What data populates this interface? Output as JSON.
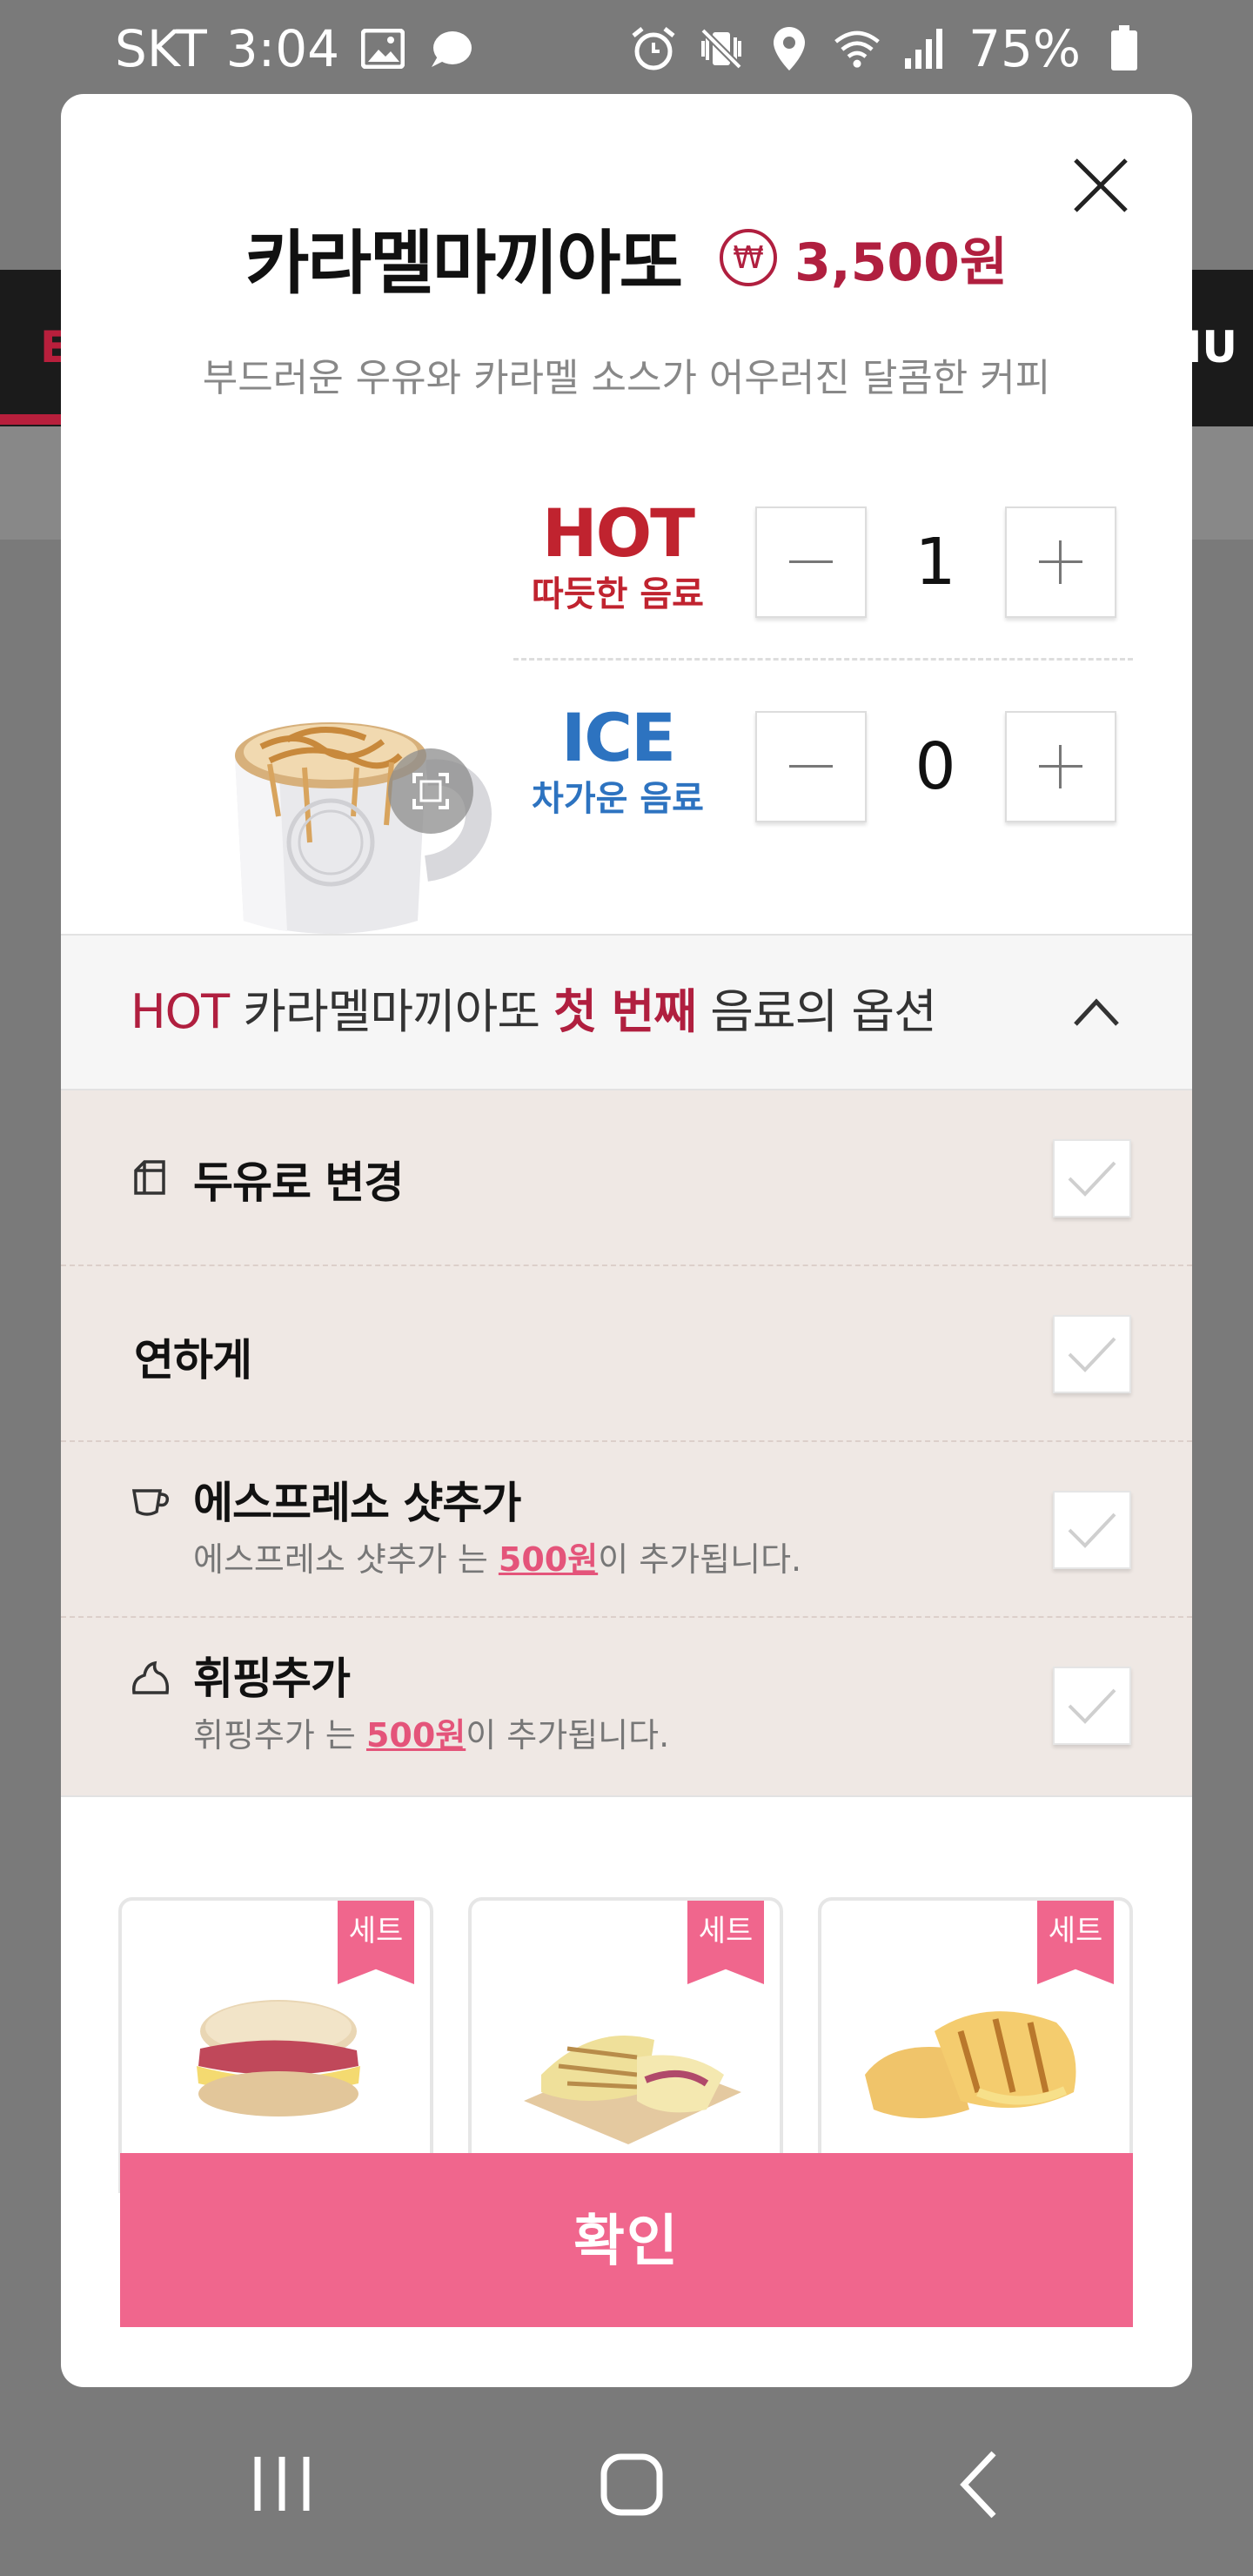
{
  "status_bar": {
    "carrier": "SKT",
    "time": "3:04",
    "battery": "75%"
  },
  "background": {
    "left_fragment": "E",
    "right_fragment": "NU"
  },
  "product": {
    "name": "카라멜마끼아또",
    "currency_icon": "₩",
    "price": "3,500원",
    "description": "부드러운 우유와 카라멜 소스가 어우러진 달콤한 커피"
  },
  "temperatures": [
    {
      "label": "HOT",
      "sublabel": "따듯한 음료",
      "quantity": "1",
      "color": "#c0232f"
    },
    {
      "label": "ICE",
      "sublabel": "차가운 음료",
      "quantity": "0",
      "color": "#2d73c0"
    }
  ],
  "options_header": {
    "prefix": "HOT",
    "name": " 카라멜마끼아또 ",
    "ordinal": "첫 번째",
    "suffix": " 음료의 옵션"
  },
  "options": [
    {
      "title": "두유로 변경",
      "icon": "milk-carton-icon",
      "desc_prefix": "",
      "desc_price": "",
      "desc_suffix": "",
      "checked": false
    },
    {
      "title": "연하게",
      "icon": "",
      "desc_prefix": "",
      "desc_price": "",
      "desc_suffix": "",
      "checked": false
    },
    {
      "title": "에스프레소 샷추가",
      "icon": "cup-icon",
      "desc_prefix": "에스프레소 샷추가 는 ",
      "desc_price": "500원",
      "desc_suffix": "이 추가됩니다.",
      "checked": false
    },
    {
      "title": "휘핑추가",
      "icon": "whipped-cream-icon",
      "desc_prefix": "휘핑추가 는 ",
      "desc_price": "500원",
      "desc_suffix": "이 추가됩니다.",
      "checked": false
    }
  ],
  "set_menu": {
    "badge": "세트",
    "items": [
      "muffin-sandwich",
      "panini-plate",
      "grilled-panini"
    ]
  },
  "confirm_label": "확인",
  "colors": {
    "brand_red": "#b01f3f",
    "accent_pink": "#f0668d",
    "hot_red": "#c0232f",
    "ice_blue": "#2d73c0",
    "options_bg": "#efe8e4"
  }
}
